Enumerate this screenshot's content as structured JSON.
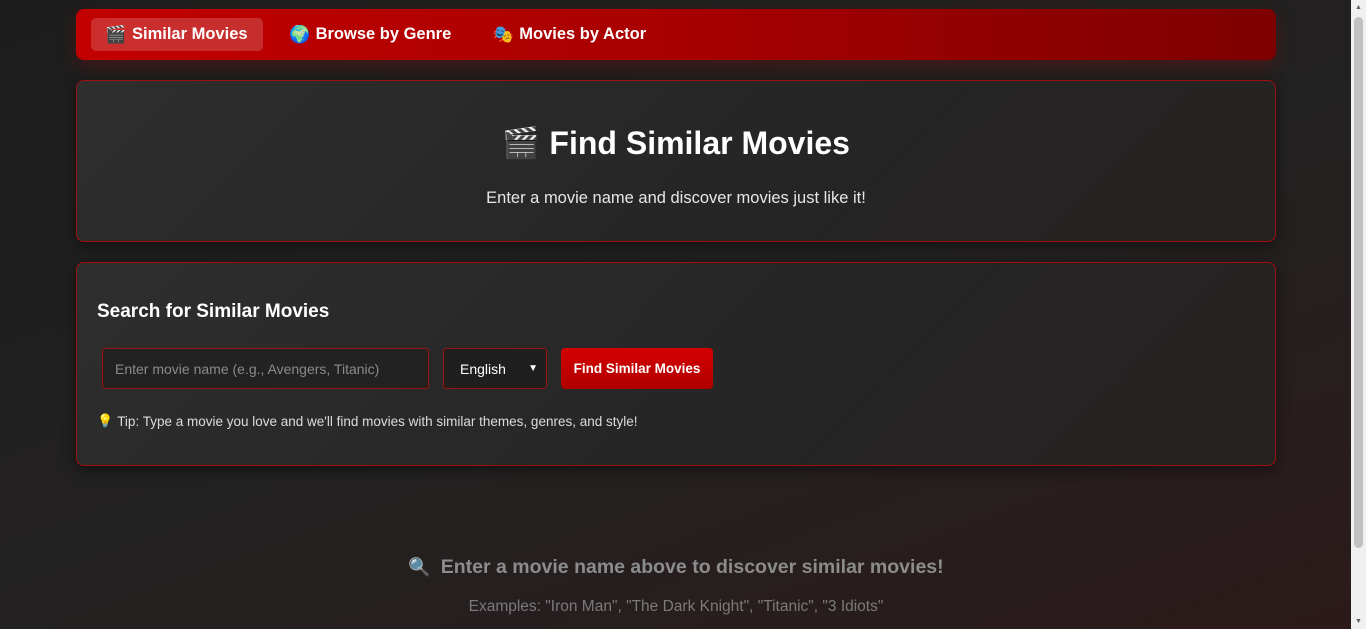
{
  "nav": {
    "items": [
      {
        "label": "Similar Movies",
        "icon": "🎬",
        "active": true
      },
      {
        "label": "Browse by Genre",
        "icon": "🌍",
        "active": false
      },
      {
        "label": "Movies by Actor",
        "icon": "🎭",
        "active": false
      }
    ]
  },
  "hero": {
    "icon": "🎬",
    "title": "Find Similar Movies",
    "subtitle": "Enter a movie name and discover movies just like it!"
  },
  "search": {
    "heading": "Search for Similar Movies",
    "input_placeholder": "Enter movie name (e.g., Avengers, Titanic)",
    "input_value": "",
    "language_selected": "English",
    "button_label": "Find Similar Movies",
    "tip_icon": "💡",
    "tip_text": "Tip: Type a movie you love and we'll find movies with similar themes, genres, and style!"
  },
  "empty_state": {
    "icon": "🔍",
    "message": "Enter a movie name above to discover similar movies!",
    "examples": "Examples: \"Iron Man\", \"The Dark Knight\", \"Titanic\", \"3 Idiots\""
  },
  "colors": {
    "accent": "#c20000",
    "border": "#a00f0f",
    "background": "#1f1f1f"
  }
}
